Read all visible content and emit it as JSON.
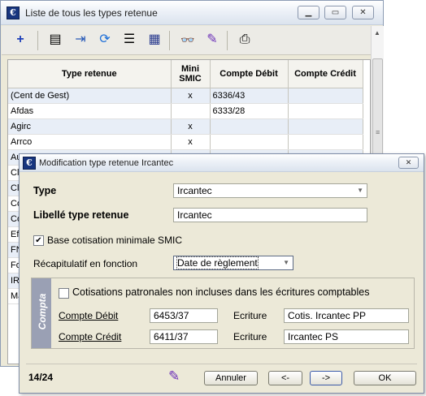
{
  "list_window": {
    "title": "Liste de tous les types retenue",
    "columns": [
      "Type retenue",
      "Mini SMIC",
      "Compte Débit",
      "Compte Crédit"
    ],
    "rows": [
      {
        "type": "(Cent de Gest)",
        "smic": "x",
        "debit": "6336/43",
        "credit": ""
      },
      {
        "type": "Afdas",
        "smic": "",
        "debit": "6333/28",
        "credit": ""
      },
      {
        "type": "Agirc",
        "smic": "x",
        "debit": "",
        "credit": ""
      },
      {
        "type": "Arrco",
        "smic": "x",
        "debit": "",
        "credit": ""
      }
    ],
    "truncated_rows": [
      "Au",
      "Cl",
      "Cl",
      "Co",
      "Co",
      "Ef",
      "FN",
      "Fo",
      "IR",
      "Ma"
    ]
  },
  "dialog": {
    "title": "Modification type retenue Ircantec",
    "type_label": "Type",
    "type_value": "Ircantec",
    "libelle_label": "Libellé type retenue",
    "libelle_value": "Ircantec",
    "base_smic_label": "Base cotisation minimale SMIC",
    "recap_label": "Récapitulatif en fonction",
    "recap_value": "Date de règlement",
    "compta_tab": "Compta",
    "cotisations_label": "Cotisations patronales non incluses dans les écritures comptables",
    "compte_debit_label": "Compte Débit",
    "compte_debit_value": "6453/37",
    "ecriture_label": "Ecriture",
    "ecriture_debit_value": "Cotis. Ircantec PP",
    "compte_credit_label": "Compte Crédit",
    "compte_credit_value": "6411/37",
    "ecriture_credit_value": "Ircantec PS",
    "record_position": "14/24",
    "annuler": "Annuler",
    "prev": "<-",
    "next": "->",
    "ok": "OK"
  }
}
